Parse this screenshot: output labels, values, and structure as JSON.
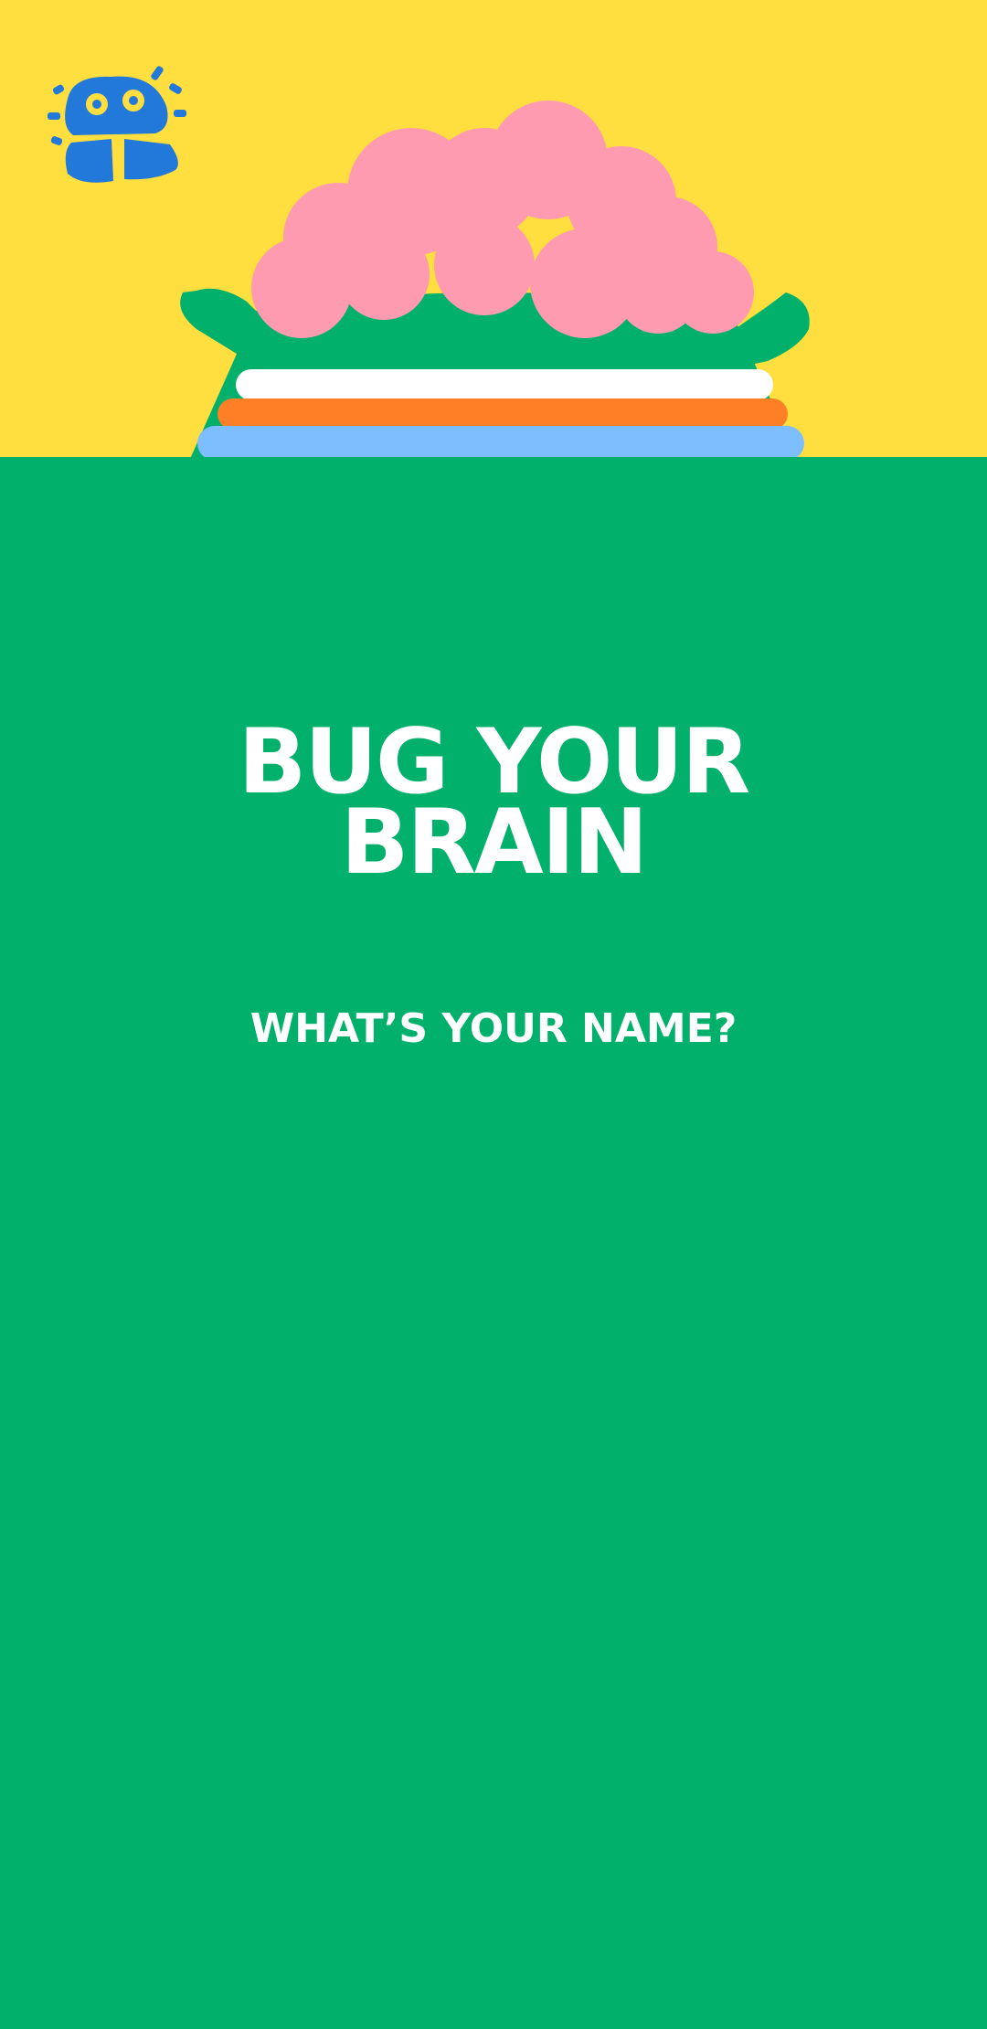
{
  "app": {
    "title_line1": "BUG YOUR",
    "title_line2": "BRAIN",
    "name_prompt": "WHAT’S YOUR NAME?"
  },
  "icons": {
    "logo": "bug-logo-icon",
    "mascot": "green-bug-mascot"
  },
  "colors": {
    "background_yellow": "#FFDE3F",
    "body_green": "#00B06B",
    "brain_pink": "#FF9BB1",
    "headband_white": "#FFFFFF",
    "headband_orange": "#FF7F27",
    "headband_blue": "#7DBEFF",
    "logo_blue": "#2379D9",
    "text": "#FFFFFF"
  }
}
